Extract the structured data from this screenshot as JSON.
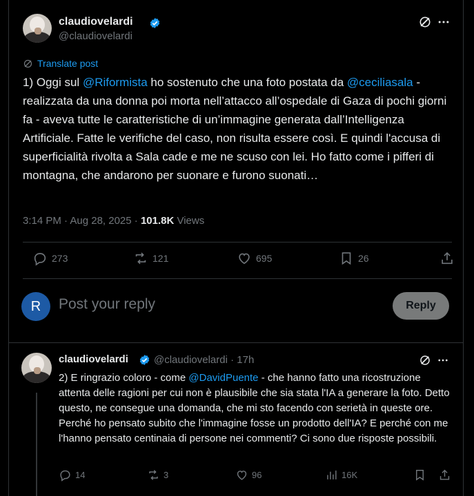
{
  "main_tweet": {
    "display_name": "claudiovelardi",
    "handle": "@claudiovelardi",
    "translate_label": "Translate post",
    "text_parts": {
      "p1": "1) Oggi sul ",
      "m1": "@Riformista",
      "p2": " ho sostenuto che una foto postata da ",
      "m2": "@ceciliasala",
      "p3": " - realizzata da una donna poi morta nell’attacco all’ospedale di Gaza di pochi giorni fa - aveva tutte le caratteristiche di un’immagine generata dall’Intelligenza Artificiale. Fatte le verifiche del caso, non risulta essere così. E quindi l'accusa di superficialità rivolta a Sala cade e me ne scuso con lei. Ho fatto come i pifferi di montagna, che andarono per suonare e furono suonati…"
    },
    "time": "3:14 PM · Aug 28, 2025 · ",
    "views_count": "101.8K",
    "views_label": " Views",
    "replies": "273",
    "reposts": "121",
    "likes": "695",
    "bookmarks": "26"
  },
  "composer": {
    "avatar_letter": "R",
    "placeholder": "Post your reply",
    "button_label": "Reply"
  },
  "reply_tweet": {
    "display_name": "claudiovelardi",
    "handle_time": "@claudiovelardi · 17h",
    "text_parts": {
      "p1": "2) E ringrazio coloro - come ",
      "m1": "@DavidPuente",
      "p2": " - che hanno fatto una ricostruzione attenta delle ragioni per cui non è plausibile che sia stata l'IA a generare la foto. Detto questo, ne consegue una domanda, che mi sto facendo con serietà in queste ore. Perché ho pensato subito che l'immagine fosse un prodotto dell'IA? E perché con me l'hanno pensato centinaia di persone nei commenti? Ci sono due risposte possibili."
    },
    "replies": "14",
    "reposts": "3",
    "likes": "96",
    "views": "16K"
  },
  "colors": {
    "accent": "#1d9bf0",
    "muted": "#71767b",
    "text": "#e7e9ea",
    "border": "#2f3336",
    "background": "#000000"
  },
  "icons": [
    "verified-badge-icon",
    "grok-icon",
    "more-icon",
    "translate-icon",
    "reply-icon",
    "repost-icon",
    "like-icon",
    "bookmark-icon",
    "share-icon",
    "views-icon"
  ]
}
